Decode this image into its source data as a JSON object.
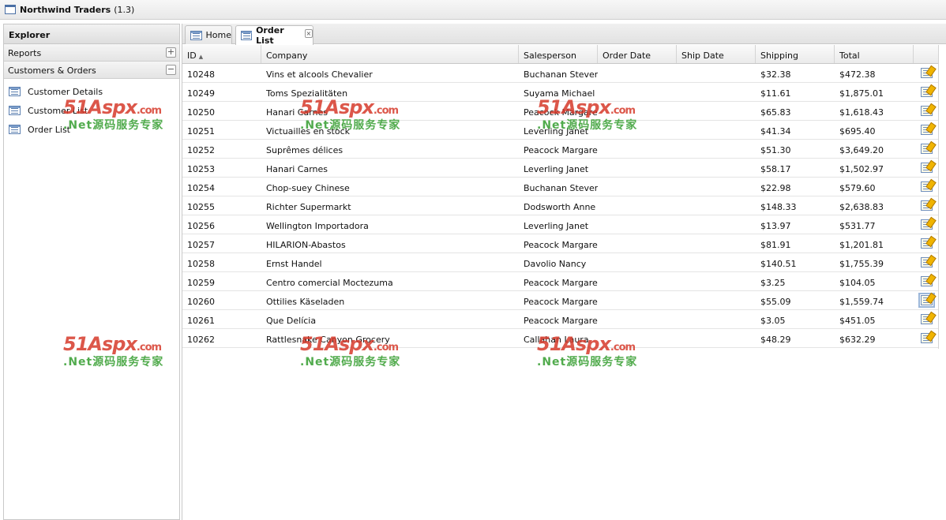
{
  "window": {
    "title": "Northwind Traders",
    "version": "(1.3)"
  },
  "explorer": {
    "title": "Explorer",
    "sections": [
      {
        "label": "Reports",
        "toggle": "+"
      },
      {
        "label": "Customers & Orders",
        "toggle": "−"
      }
    ],
    "items": [
      "Customer Details",
      "Customer List",
      "Order List"
    ]
  },
  "tabs": [
    {
      "label": "Home",
      "icon": "list-icon"
    },
    {
      "label": "Order List",
      "icon": "list-icon",
      "close": "×"
    }
  ],
  "grid": {
    "columns": [
      "ID",
      "Company",
      "Salesperson",
      "Order Date",
      "Ship Date",
      "Shipping",
      "Total"
    ],
    "sort_indicator": "▲",
    "rows": [
      {
        "id": "10248",
        "company": "Vins et alcools Chevalier",
        "salesperson": "Buchanan Steven",
        "order_date": "",
        "ship_date": "",
        "shipping": "$32.38",
        "total": "$472.38"
      },
      {
        "id": "10249",
        "company": "Toms Spezialitäten",
        "salesperson": "Suyama Michael",
        "order_date": "",
        "ship_date": "",
        "shipping": "$11.61",
        "total": "$1,875.01"
      },
      {
        "id": "10250",
        "company": "Hanari Carnes",
        "salesperson": "Peacock Margaret",
        "order_date": "",
        "ship_date": "",
        "shipping": "$65.83",
        "total": "$1,618.43"
      },
      {
        "id": "10251",
        "company": "Victuailles en stock",
        "salesperson": "Leverling Janet",
        "order_date": "",
        "ship_date": "",
        "shipping": "$41.34",
        "total": "$695.40"
      },
      {
        "id": "10252",
        "company": "Suprêmes délices",
        "salesperson": "Peacock Margaret",
        "order_date": "",
        "ship_date": "",
        "shipping": "$51.30",
        "total": "$3,649.20"
      },
      {
        "id": "10253",
        "company": "Hanari Carnes",
        "salesperson": "Leverling Janet",
        "order_date": "",
        "ship_date": "",
        "shipping": "$58.17",
        "total": "$1,502.97"
      },
      {
        "id": "10254",
        "company": "Chop-suey Chinese",
        "salesperson": "Buchanan Steven",
        "order_date": "",
        "ship_date": "",
        "shipping": "$22.98",
        "total": "$579.60"
      },
      {
        "id": "10255",
        "company": "Richter Supermarkt",
        "salesperson": "Dodsworth Anne",
        "order_date": "",
        "ship_date": "",
        "shipping": "$148.33",
        "total": "$2,638.83"
      },
      {
        "id": "10256",
        "company": "Wellington Importadora",
        "salesperson": "Leverling Janet",
        "order_date": "",
        "ship_date": "",
        "shipping": "$13.97",
        "total": "$531.77"
      },
      {
        "id": "10257",
        "company": "HILARION-Abastos",
        "salesperson": "Peacock Margaret",
        "order_date": "",
        "ship_date": "",
        "shipping": "$81.91",
        "total": "$1,201.81"
      },
      {
        "id": "10258",
        "company": "Ernst Handel",
        "salesperson": "Davolio Nancy",
        "order_date": "",
        "ship_date": "",
        "shipping": "$140.51",
        "total": "$1,755.39"
      },
      {
        "id": "10259",
        "company": "Centro comercial Moctezuma",
        "salesperson": "Peacock Margaret",
        "order_date": "",
        "ship_date": "",
        "shipping": "$3.25",
        "total": "$104.05"
      },
      {
        "id": "10260",
        "company": "Ottilies Käseladen",
        "salesperson": "Peacock Margaret",
        "order_date": "",
        "ship_date": "",
        "shipping": "$55.09",
        "total": "$1,559.74"
      },
      {
        "id": "10261",
        "company": "Que Delícia",
        "salesperson": "Peacock Margaret",
        "order_date": "",
        "ship_date": "",
        "shipping": "$3.05",
        "total": "$451.05"
      },
      {
        "id": "10262",
        "company": "Rattlesnake Canyon Grocery",
        "salesperson": "Callahan Laura",
        "order_date": "",
        "ship_date": "",
        "shipping": "$48.29",
        "total": "$632.29"
      }
    ],
    "row_action_icon": "edit-icon"
  },
  "watermark": {
    "logo": "51Aspx",
    "domain": ".com",
    "tagline": ".Net源码服务专家"
  },
  "colors": {
    "watermark_red": "#d63a2b",
    "watermark_green": "#3fa33a",
    "accent_blue": "#5b7fb0"
  }
}
